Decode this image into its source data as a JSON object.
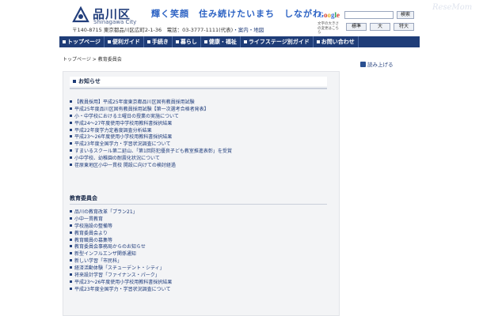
{
  "header": {
    "logo_name": "品川区",
    "logo_sub": "Shinagawa City",
    "slogan": "輝く笑顔　住み続けたいまち　しながわ",
    "address": "〒140-8715 東京都品川区広町2-1-36　電話：03-3777-1111(代表)",
    "map_link": "・案内・地図",
    "search_button": "検索",
    "font_note": "文字の大きさの変更はこちら",
    "font_buttons": [
      "標準",
      "大",
      "特大"
    ]
  },
  "nav": [
    "トップページ",
    "便利ガイド",
    "手続き",
    "暮らし",
    "健康・福祉",
    "ライフステージ別ガイド",
    "お問い合わせ"
  ],
  "breadcrumb": "トップページ > 教育委員会",
  "read_aloud": "読み上げる",
  "notice": {
    "heading": "お知らせ",
    "items": [
      "【教員採用】平成25年度東京都品川区固有教員採用試験",
      "平成25年度品川区固有教員採用試験【第一次選考合格者発表】",
      "小・中学校における土曜日の授業の実施について",
      "平成24〜27年度使用中学校用教科書採択結果",
      "平成22年度学力定着度調査分析結果",
      "平成23〜26年度使用小学校用教科書採択結果",
      "平成23年度全国学力・学習状況調査について",
      "すまいるスクール第二延山、「第1回防犯優良子ども教室推進表彰」を受賞",
      "小中学校、幼稚園の耐震化状況について",
      "荏原東地区小中一貫校 開設に向けての検討経過"
    ]
  },
  "board": {
    "heading": "教育委員会",
    "items": [
      "品川の教育改革「プラン21」",
      "小中一貫教育",
      "学校施設の整備等",
      "教育委員会より",
      "教育職員の募集等",
      "教育委員会事務局からのお知らせ",
      "新型インフルエンザ関係通知",
      "新しい学習「市民科」",
      "経済活動体験「スチューデント・シティ」",
      "将来設計学習「ファイナンス・パーク」",
      "平成23〜26年度使用小学校用教科書採択結果",
      "平成23年度全国学力・学習状況調査について"
    ]
  },
  "watermark": "ReseMom",
  "colors": {
    "nav_bg": "#1f3d78",
    "link": "#1d3a7a",
    "content_bg": "#f3f4f6"
  }
}
